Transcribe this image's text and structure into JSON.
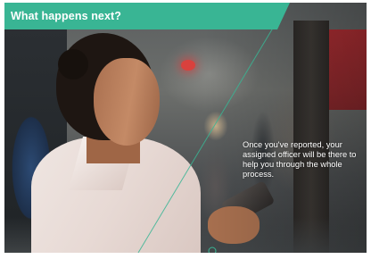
{
  "header": {
    "title": "What happens next?"
  },
  "body": {
    "caption": "Once you've reported, your assigned officer will be there to help you through the whole process."
  },
  "colors": {
    "accent": "#39b594"
  },
  "icons": {
    "diagonal": "diagonal-line",
    "nav": "circle-arrow-icon"
  }
}
